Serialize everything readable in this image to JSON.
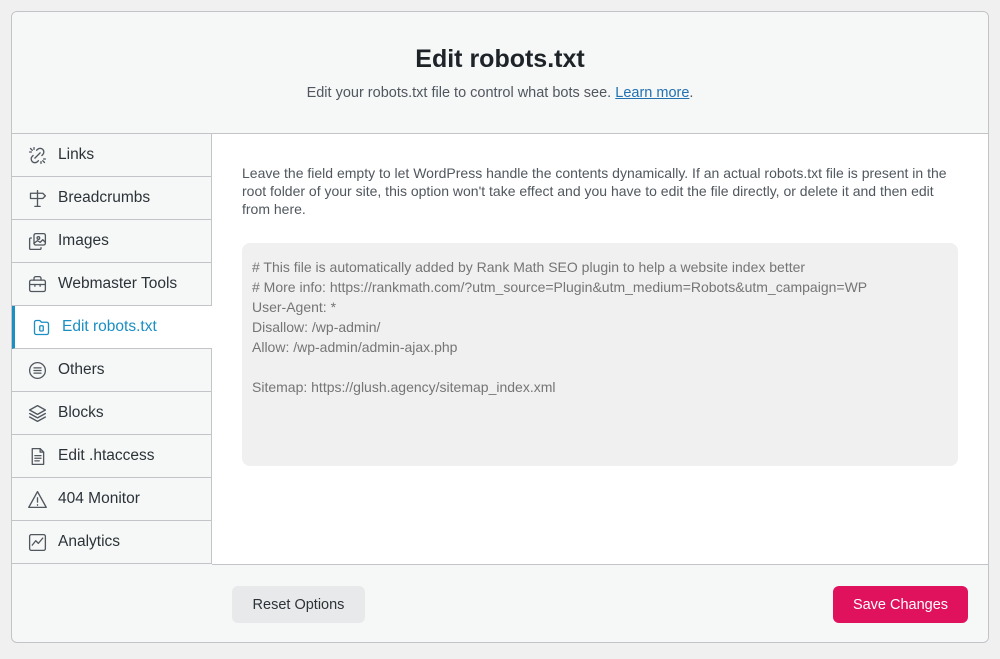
{
  "header": {
    "title": "Edit robots.txt",
    "subtitle": "Edit your robots.txt file to control what bots see.",
    "learn_more": "Learn more",
    "subtitle_end": "."
  },
  "sidebar": {
    "items": [
      {
        "label": "Links",
        "icon": "links-icon"
      },
      {
        "label": "Breadcrumbs",
        "icon": "signpost-icon"
      },
      {
        "label": "Images",
        "icon": "images-icon"
      },
      {
        "label": "Webmaster Tools",
        "icon": "toolbox-icon"
      },
      {
        "label": "Edit robots.txt",
        "icon": "robots-file-icon",
        "active": true
      },
      {
        "label": "Others",
        "icon": "list-circle-icon"
      },
      {
        "label": "Blocks",
        "icon": "blocks-icon"
      },
      {
        "label": "Edit .htaccess",
        "icon": "document-icon"
      },
      {
        "label": "404 Monitor",
        "icon": "warning-icon"
      },
      {
        "label": "Analytics",
        "icon": "analytics-icon"
      }
    ]
  },
  "main": {
    "description": "Leave the field empty to let WordPress handle the contents dynamically. If an actual robots.txt file is present in the root folder of your site, this option won't take effect and you have to edit the file directly, or delete it and then edit from here.",
    "robots_placeholder": "# This file is automatically added by Rank Math SEO plugin to help a website index better\n# More info: https://rankmath.com/?utm_source=Plugin&utm_medium=Robots&utm_campaign=WP\nUser-Agent: *\nDisallow: /wp-admin/\nAllow: /wp-admin/admin-ajax.php\n\nSitemap: https://glush.agency/sitemap_index.xml"
  },
  "footer": {
    "reset_label": "Reset Options",
    "save_label": "Save Changes"
  },
  "colors": {
    "accent": "#1a8fc2",
    "save_button": "#e0125e",
    "link": "#2271b1"
  }
}
